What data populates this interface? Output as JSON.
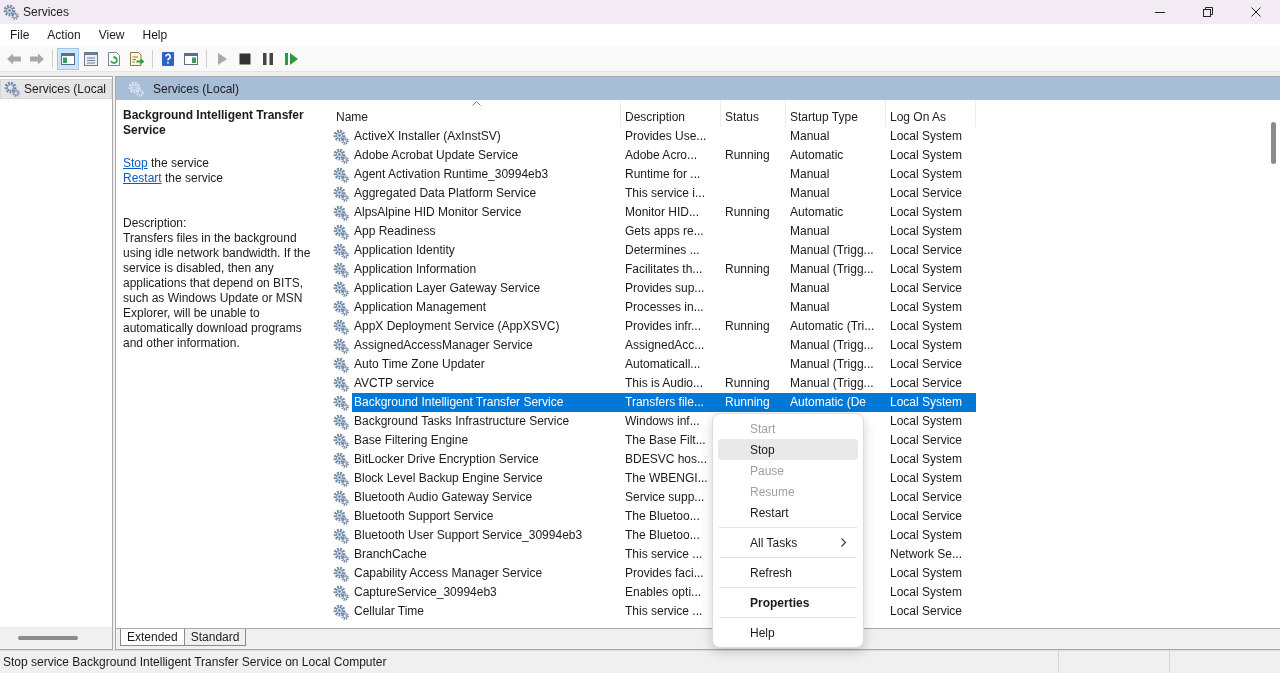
{
  "window": {
    "title": "Services"
  },
  "menu_bar": [
    "File",
    "Action",
    "View",
    "Help"
  ],
  "toolbar": {
    "groups": [
      [
        {
          "kind": "back",
          "disabled": true,
          "pressed": false
        },
        {
          "kind": "forward",
          "disabled": true,
          "pressed": false
        }
      ],
      [
        {
          "kind": "console-tree",
          "disabled": false,
          "pressed": true
        },
        {
          "kind": "properties",
          "disabled": false,
          "pressed": false
        },
        {
          "kind": "refresh",
          "disabled": false,
          "pressed": false
        },
        {
          "kind": "export",
          "disabled": false,
          "pressed": false
        }
      ],
      [
        {
          "kind": "help",
          "disabled": false,
          "pressed": false
        },
        {
          "kind": "action-pane",
          "disabled": false,
          "pressed": false
        }
      ],
      [
        {
          "kind": "start",
          "disabled": true,
          "pressed": false
        },
        {
          "kind": "stop",
          "disabled": false,
          "pressed": false
        },
        {
          "kind": "pause",
          "disabled": false,
          "pressed": false
        },
        {
          "kind": "resume",
          "disabled": false,
          "pressed": false
        }
      ]
    ]
  },
  "tree": {
    "items": [
      {
        "label": "Services (Local",
        "selected": true
      }
    ]
  },
  "pane_header": {
    "title": "Services (Local)"
  },
  "details": {
    "title": "Background Intelligent Transfer Service",
    "actions": [
      {
        "link": "Stop",
        "text": "the service"
      },
      {
        "link": "Restart",
        "text": "the service"
      }
    ],
    "description_label": "Description:",
    "description": "Transfers files in the background using idle network bandwidth. If the service is disabled, then any applications that depend on BITS, such as Windows Update or MSN Explorer, will be unable to automatically download programs and other information."
  },
  "table": {
    "columns": [
      {
        "label": "Name",
        "sorted": true
      },
      {
        "label": "Description",
        "sorted": false
      },
      {
        "label": "Status",
        "sorted": false
      },
      {
        "label": "Startup Type",
        "sorted": false
      },
      {
        "label": "Log On As",
        "sorted": false
      }
    ],
    "rows": [
      {
        "name": "ActiveX Installer (AxInstSV)",
        "description": "Provides Use...",
        "startup_type": "Manual",
        "log_on_as": "Local System",
        "selected": false
      },
      {
        "name": "Adobe Acrobat Update Service",
        "description": "Adobe Acro...",
        "status": "Running",
        "startup_type": "Automatic",
        "log_on_as": "Local System",
        "selected": false
      },
      {
        "name": "Agent Activation Runtime_30994eb3",
        "description": "Runtime for ...",
        "startup_type": "Manual",
        "log_on_as": "Local System",
        "selected": false
      },
      {
        "name": "Aggregated Data Platform Service",
        "description": "This service i...",
        "startup_type": "Manual",
        "log_on_as": "Local Service",
        "selected": false
      },
      {
        "name": "AlpsAlpine HID Monitor Service",
        "description": "Monitor HID...",
        "status": "Running",
        "startup_type": "Automatic",
        "log_on_as": "Local System",
        "selected": false
      },
      {
        "name": "App Readiness",
        "description": "Gets apps re...",
        "startup_type": "Manual",
        "log_on_as": "Local System",
        "selected": false
      },
      {
        "name": "Application Identity",
        "description": "Determines ...",
        "startup_type": "Manual (Trigg...",
        "log_on_as": "Local Service",
        "selected": false
      },
      {
        "name": "Application Information",
        "description": "Facilitates th...",
        "status": "Running",
        "startup_type": "Manual (Trigg...",
        "log_on_as": "Local System",
        "selected": false
      },
      {
        "name": "Application Layer Gateway Service",
        "description": "Provides sup...",
        "startup_type": "Manual",
        "log_on_as": "Local Service",
        "selected": false
      },
      {
        "name": "Application Management",
        "description": "Processes in...",
        "startup_type": "Manual",
        "log_on_as": "Local System",
        "selected": false
      },
      {
        "name": "AppX Deployment Service (AppXSVC)",
        "description": "Provides infr...",
        "status": "Running",
        "startup_type": "Automatic (Tri...",
        "log_on_as": "Local System",
        "selected": false
      },
      {
        "name": "AssignedAccessManager Service",
        "description": "AssignedAcc...",
        "startup_type": "Manual (Trigg...",
        "log_on_as": "Local System",
        "selected": false
      },
      {
        "name": "Auto Time Zone Updater",
        "description": "Automaticall...",
        "startup_type": "Manual (Trigg...",
        "log_on_as": "Local Service",
        "selected": false
      },
      {
        "name": "AVCTP service",
        "description": "This is Audio...",
        "status": "Running",
        "startup_type": "Manual (Trigg...",
        "log_on_as": "Local Service",
        "selected": false
      },
      {
        "name": "Background Intelligent Transfer Service",
        "description": "Transfers file...",
        "status": "Running",
        "startup_type": "Automatic (De",
        "log_on_as": "Local System",
        "selected": true
      },
      {
        "name": "Background Tasks Infrastructure Service",
        "description": "Windows inf...",
        "log_on_as": "Local System",
        "selected": false
      },
      {
        "name": "Base Filtering Engine",
        "description": "The Base Filt...",
        "log_on_as": "Local Service",
        "selected": false
      },
      {
        "name": "BitLocker Drive Encryption Service",
        "description": "BDESVC hos...",
        "log_on_as": "Local System",
        "selected": false
      },
      {
        "name": "Block Level Backup Engine Service",
        "description": "The WBENGI...",
        "log_on_as": "Local System",
        "selected": false
      },
      {
        "name": "Bluetooth Audio Gateway Service",
        "description": "Service supp...",
        "log_on_as": "Local Service",
        "selected": false
      },
      {
        "name": "Bluetooth Support Service",
        "description": "The Bluetoo...",
        "log_on_as": "Local Service",
        "selected": false
      },
      {
        "name": "Bluetooth User Support Service_30994eb3",
        "description": "The Bluetoo...",
        "log_on_as": "Local System",
        "selected": false
      },
      {
        "name": "BranchCache",
        "description": "This service ...",
        "log_on_as": "Network Se...",
        "selected": false
      },
      {
        "name": "Capability Access Manager Service",
        "description": "Provides faci...",
        "log_on_as": "Local System",
        "selected": false
      },
      {
        "name": "CaptureService_30994eb3",
        "description": "Enables opti...",
        "log_on_as": "Local System",
        "selected": false
      },
      {
        "name": "Cellular Time",
        "description": "This service ...",
        "log_on_as": "Local Service",
        "selected": false
      }
    ]
  },
  "context_menu": {
    "items": [
      {
        "kind": "item",
        "label": "Start",
        "disabled": true,
        "selected": false,
        "default": false,
        "submenu": false
      },
      {
        "kind": "item",
        "label": "Stop",
        "disabled": false,
        "selected": true,
        "default": false,
        "submenu": false
      },
      {
        "kind": "item",
        "label": "Pause",
        "disabled": true,
        "selected": false,
        "default": false,
        "submenu": false
      },
      {
        "kind": "item",
        "label": "Resume",
        "disabled": true,
        "selected": false,
        "default": false,
        "submenu": false
      },
      {
        "kind": "item",
        "label": "Restart",
        "disabled": false,
        "selected": false,
        "default": false,
        "submenu": false
      },
      {
        "kind": "separator"
      },
      {
        "kind": "item",
        "label": "All Tasks",
        "disabled": false,
        "selected": false,
        "default": false,
        "submenu": true
      },
      {
        "kind": "separator"
      },
      {
        "kind": "item",
        "label": "Refresh",
        "disabled": false,
        "selected": false,
        "default": false,
        "submenu": false
      },
      {
        "kind": "separator"
      },
      {
        "kind": "item",
        "label": "Properties",
        "disabled": false,
        "selected": false,
        "default": true,
        "submenu": false
      },
      {
        "kind": "separator"
      },
      {
        "kind": "item",
        "label": "Help",
        "disabled": false,
        "selected": false,
        "default": false,
        "submenu": false
      }
    ]
  },
  "bottom_tabs": [
    {
      "label": "Extended",
      "selected": true
    },
    {
      "label": "Standard",
      "selected": false
    }
  ],
  "status_bar": {
    "text": "Stop service Background Intelligent Transfer Service on Local Computer"
  }
}
